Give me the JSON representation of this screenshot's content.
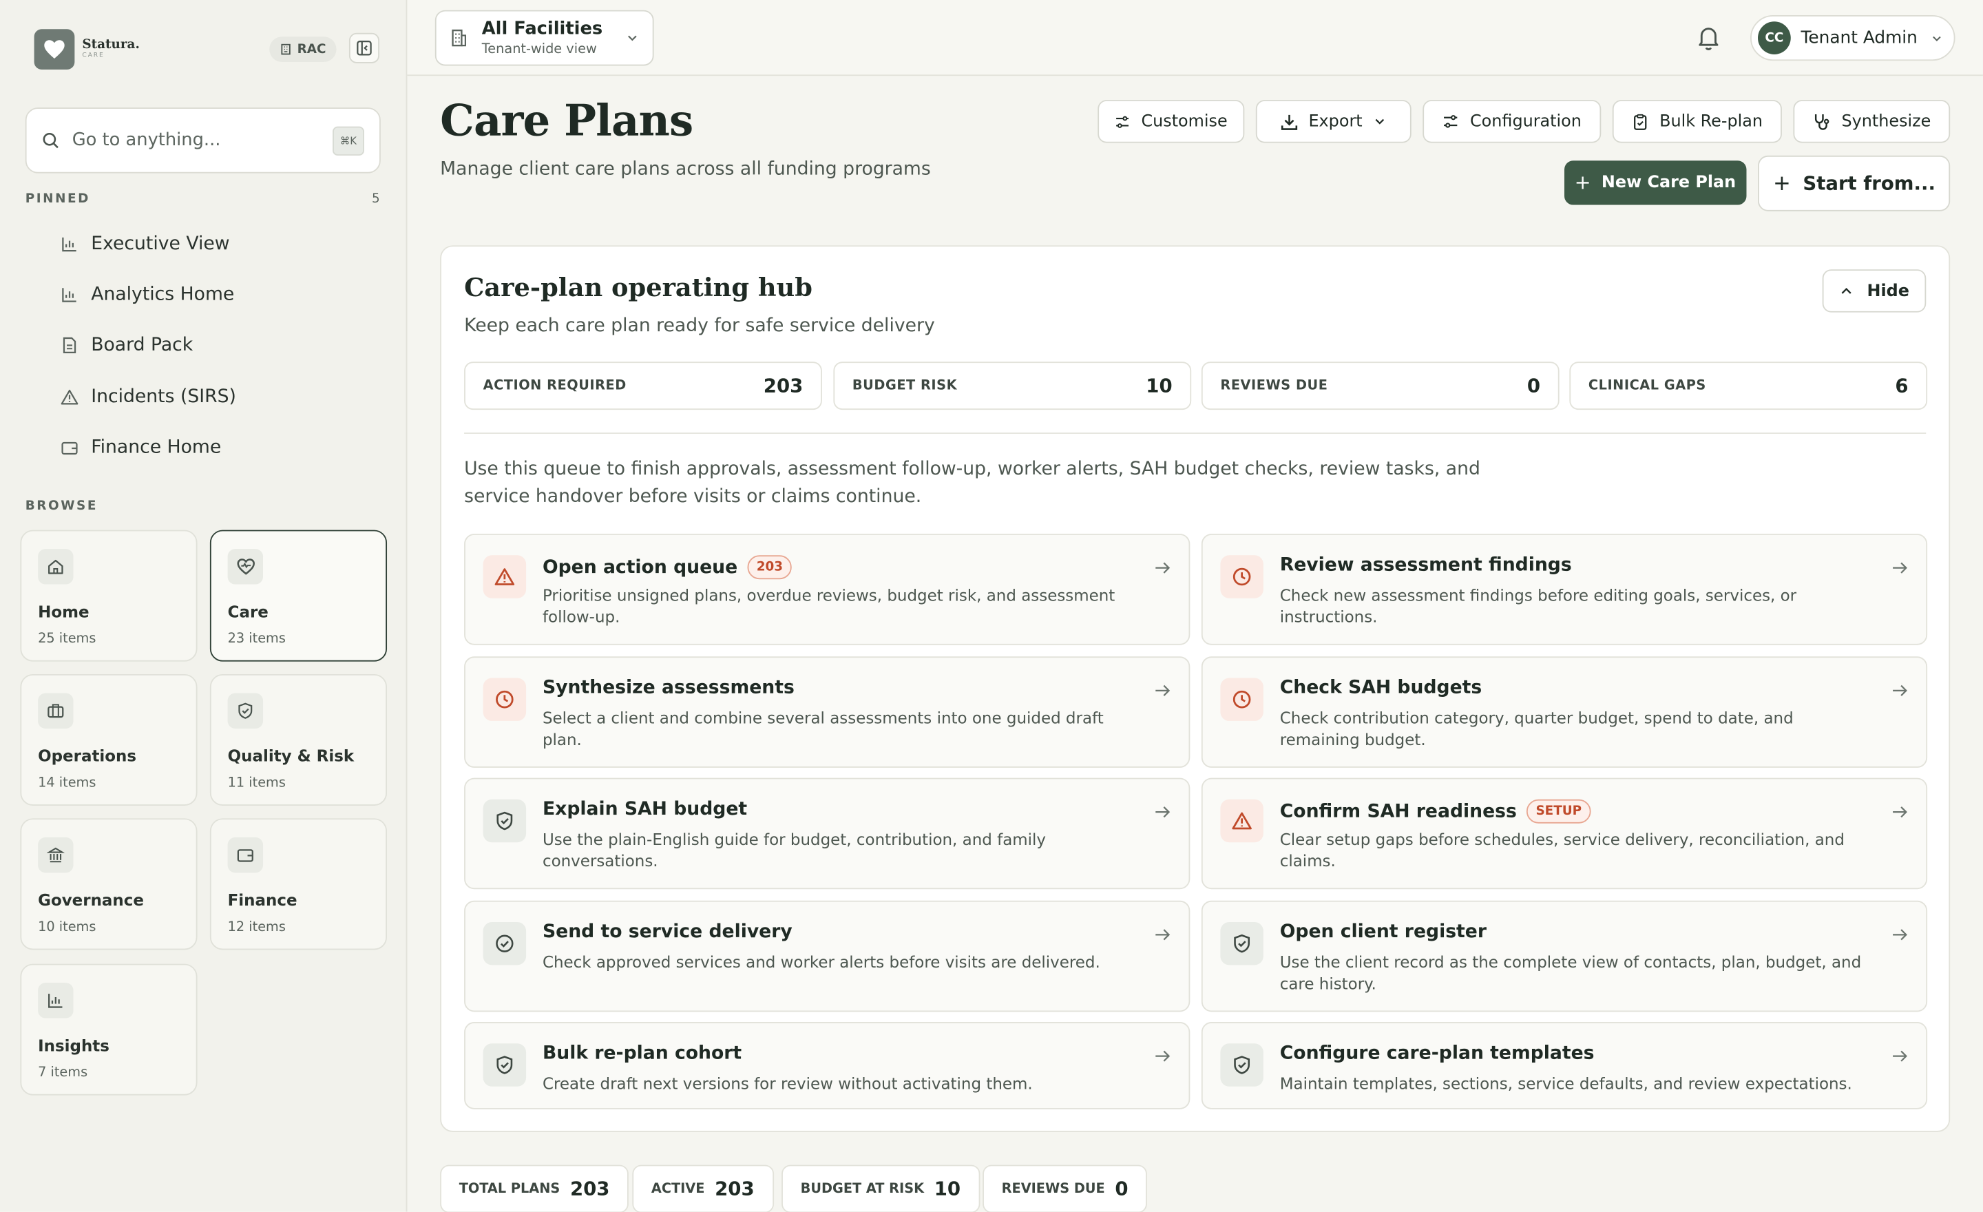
{
  "brand": {
    "name": "Statura.",
    "sub": "CARE"
  },
  "tenant_tag": "RAC",
  "search": {
    "placeholder": "Go to anything...",
    "shortcut": "⌘K"
  },
  "pinned": {
    "label": "PINNED",
    "count": "5",
    "items": [
      {
        "label": "Executive View",
        "icon": "chart-icon"
      },
      {
        "label": "Analytics Home",
        "icon": "chart-icon"
      },
      {
        "label": "Board Pack",
        "icon": "document-icon"
      },
      {
        "label": "Incidents (SIRS)",
        "icon": "warning-icon"
      },
      {
        "label": "Finance Home",
        "icon": "wallet-icon"
      }
    ]
  },
  "browse": {
    "label": "BROWSE",
    "cards": [
      {
        "title": "Home",
        "count": "25 items",
        "icon": "home-icon"
      },
      {
        "title": "Care",
        "count": "23 items",
        "icon": "heart-icon"
      },
      {
        "title": "Operations",
        "count": "14 items",
        "icon": "briefcase-icon"
      },
      {
        "title": "Quality & Risk",
        "count": "11 items",
        "icon": "shield-icon"
      },
      {
        "title": "Governance",
        "count": "10 items",
        "icon": "landmark-icon"
      },
      {
        "title": "Finance",
        "count": "12 items",
        "icon": "wallet-icon"
      },
      {
        "title": "Insights",
        "count": "7 items",
        "icon": "chart-icon"
      }
    ]
  },
  "facility": {
    "title": "All Facilities",
    "subtitle": "Tenant-wide view"
  },
  "user": {
    "initials": "CC",
    "name": "Tenant Admin"
  },
  "page": {
    "title": "Care Plans",
    "subtitle": "Manage client care plans across all funding programs"
  },
  "toolbar": {
    "customise": "Customise",
    "export": "Export",
    "configuration": "Configuration",
    "bulk_replan": "Bulk Re-plan",
    "synthesize": "Synthesize",
    "new_plan": "New Care Plan",
    "start_from": "Start from..."
  },
  "hub": {
    "title": "Care-plan operating hub",
    "subtitle": "Keep each care plan ready for safe service delivery",
    "hide": "Hide",
    "stats": [
      {
        "label": "ACTION REQUIRED",
        "value": "203"
      },
      {
        "label": "BUDGET RISK",
        "value": "10"
      },
      {
        "label": "REVIEWS DUE",
        "value": "0"
      },
      {
        "label": "CLINICAL GAPS",
        "value": "6"
      }
    ],
    "description": "Use this queue to finish approvals, assessment follow-up, worker alerts, SAH budget checks, review tasks, and service handover before visits or claims continue.",
    "actions": [
      {
        "title": "Open action queue",
        "badge": "203",
        "desc": "Prioritise unsigned plans, overdue reviews, budget risk, and assessment follow-up.",
        "icon": "warning-icon",
        "tone": "warn"
      },
      {
        "title": "Review assessment findings",
        "badge": "",
        "desc": "Check new assessment findings before editing goals, services, or instructions.",
        "icon": "clock-icon",
        "tone": "warn"
      },
      {
        "title": "Synthesize assessments",
        "badge": "",
        "desc": "Select a client and combine several assessments into one guided draft plan.",
        "icon": "clock-icon",
        "tone": "warn"
      },
      {
        "title": "Check SAH budgets",
        "badge": "",
        "desc": "Check contribution category, quarter budget, spend to date, and remaining budget.",
        "icon": "clock-icon",
        "tone": "warn"
      },
      {
        "title": "Explain SAH budget",
        "badge": "",
        "desc": "Use the plain-English guide for budget, contribution, and family conversations.",
        "icon": "shield-icon",
        "tone": "ok"
      },
      {
        "title": "Confirm SAH readiness",
        "badge": "SETUP",
        "desc": "Clear setup gaps before schedules, service delivery, reconciliation, and claims.",
        "icon": "warning-icon",
        "tone": "warn"
      },
      {
        "title": "Send to service delivery",
        "badge": "",
        "desc": "Check approved services and worker alerts before visits are delivered.",
        "icon": "check-circle-icon",
        "tone": "ok"
      },
      {
        "title": "Open client register",
        "badge": "",
        "desc": "Use the client record as the complete view of contacts, plan, budget, and care history.",
        "icon": "shield-icon",
        "tone": "ok"
      },
      {
        "title": "Bulk re-plan cohort",
        "badge": "",
        "desc": "Create draft next versions for review without activating them.",
        "icon": "shield-icon",
        "tone": "ok"
      },
      {
        "title": "Configure care-plan templates",
        "badge": "",
        "desc": "Maintain templates, sections, service defaults, and review expectations.",
        "icon": "shield-icon",
        "tone": "ok"
      }
    ]
  },
  "summary": [
    {
      "label": "TOTAL PLANS",
      "value": "203"
    },
    {
      "label": "ACTIVE",
      "value": "203"
    },
    {
      "label": "BUDGET AT RISK",
      "value": "10"
    },
    {
      "label": "REVIEWS DUE",
      "value": "0"
    }
  ],
  "colors": {
    "accent": "#3e5a47",
    "warning": "#c04a2a",
    "background": "#f5f5f0"
  }
}
